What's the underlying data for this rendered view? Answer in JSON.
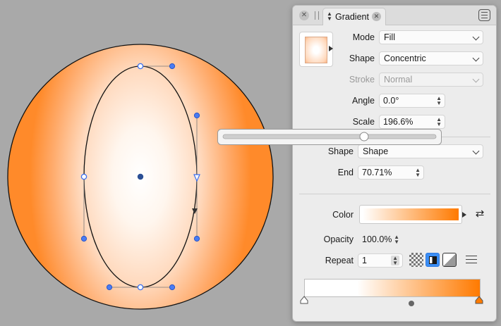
{
  "panel": {
    "tab_title": "Gradient",
    "mode": {
      "label": "Mode",
      "value": "Fill"
    },
    "shape": {
      "label": "Shape",
      "value": "Concentric"
    },
    "stroke": {
      "label": "Stroke",
      "value": "Normal"
    },
    "angle": {
      "label": "Angle",
      "value": "0.0°"
    },
    "scale": {
      "label": "Scale",
      "value": "196.6%",
      "slider_fraction": 0.65
    },
    "end_shape": {
      "label": "Shape",
      "value": "Shape"
    },
    "end": {
      "label": "End",
      "value": "70.71%"
    },
    "color": {
      "label": "Color",
      "from": "#ffffff",
      "to": "#ff7a00"
    },
    "opacity": {
      "label": "Opacity",
      "value": "100.0%"
    },
    "repeat": {
      "label": "Repeat",
      "value": "1"
    },
    "gradient_stops": [
      {
        "position": 0.0,
        "color": "#ffffff"
      },
      {
        "position": 1.0,
        "color": "#ff7a00"
      }
    ],
    "midpoint": 0.6
  },
  "colors": {
    "canvas_bg": "#a9a9a9",
    "accent": "#3b8ef5",
    "gradient_outer": "#ff8a2a",
    "handle_blue": "#3a6ff0"
  }
}
